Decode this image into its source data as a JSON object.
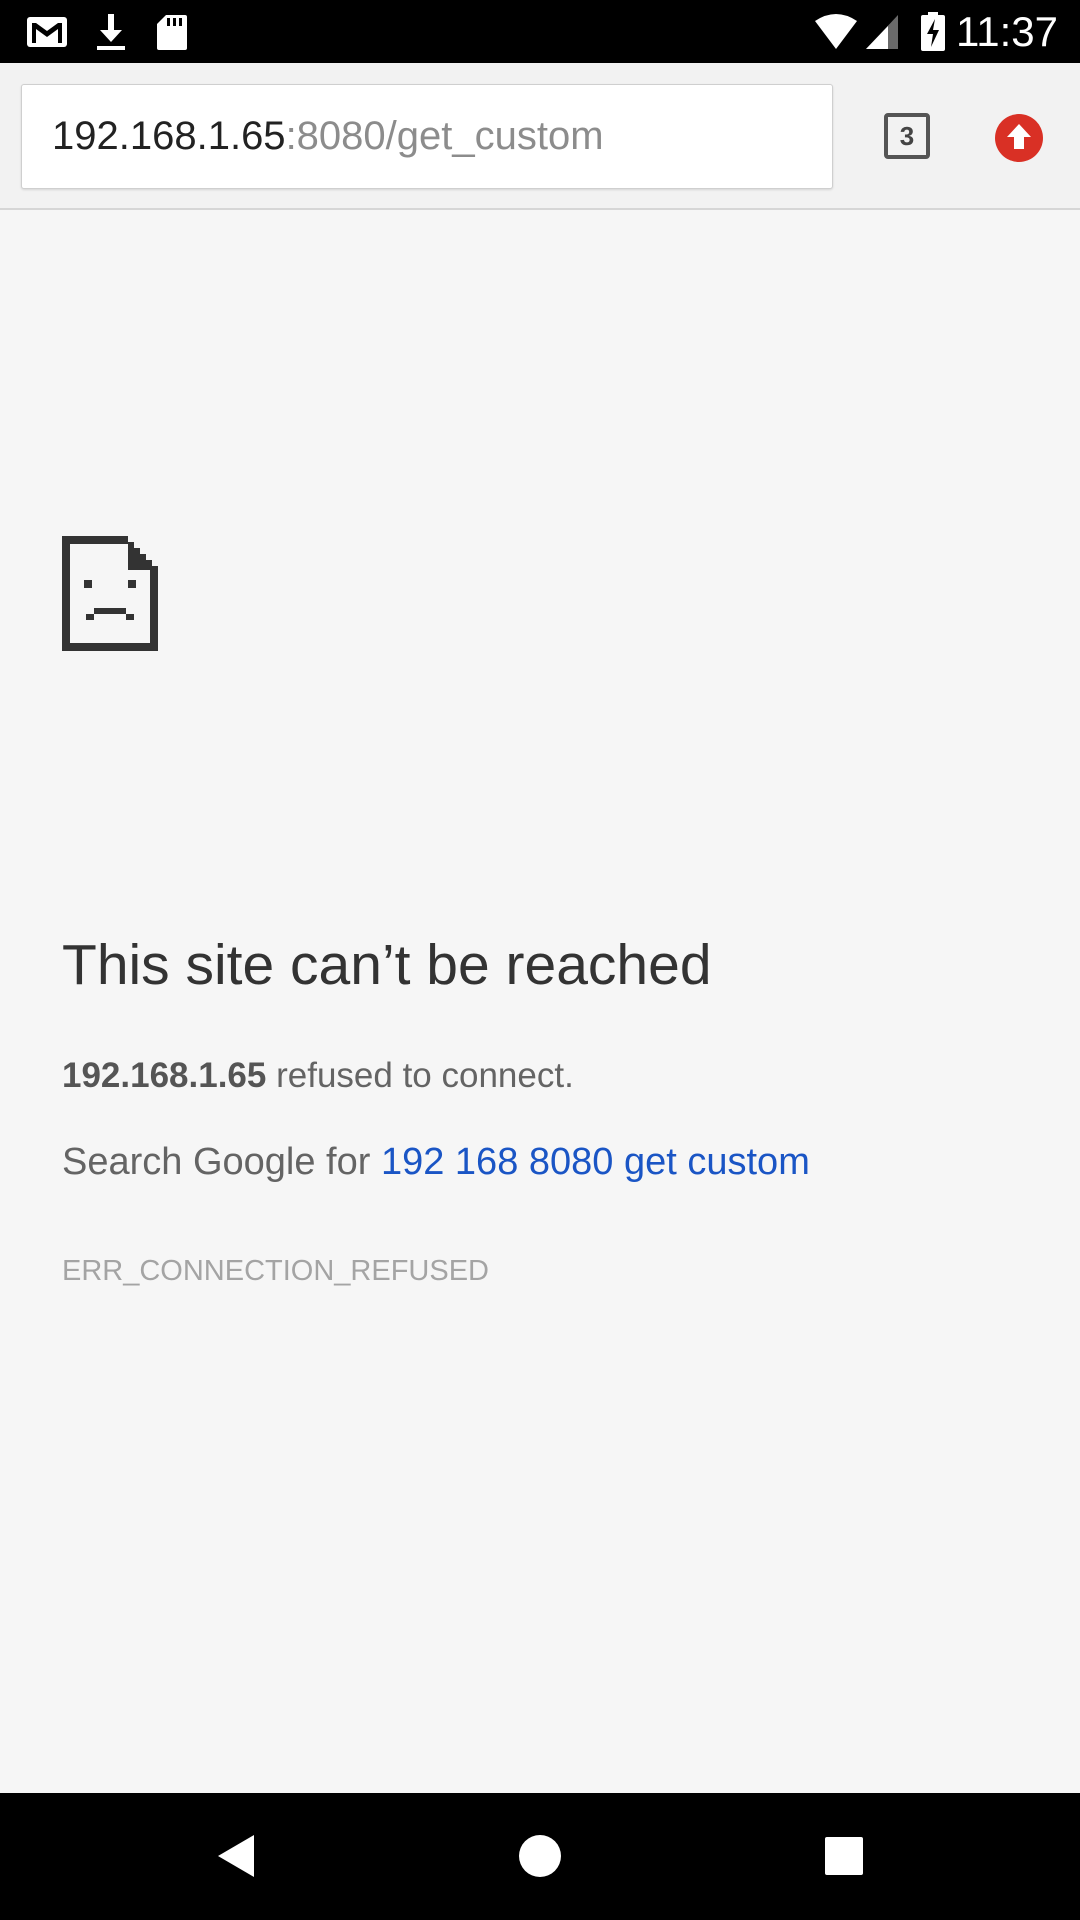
{
  "status_bar": {
    "time": "11:37",
    "icons_left": [
      "gmail-icon",
      "download-icon",
      "sd-card-icon"
    ],
    "icons_right": [
      "wifi-icon",
      "cell-signal-icon",
      "battery-charging-icon"
    ]
  },
  "toolbar": {
    "url_host": "192.168.1.65",
    "url_path": ":8080/get_custom",
    "tab_count": "3",
    "update_icon": "update-arrow-icon"
  },
  "error_page": {
    "icon": "sad-page-icon",
    "title": "This site can’t be reached",
    "host": "192.168.1.65",
    "refused_suffix": " refused to connect.",
    "search_prefix": "Search Google for ",
    "search_link": "192 168 8080 get custom",
    "error_code": "ERR_CONNECTION_REFUSED"
  },
  "nav_bar": {
    "buttons": [
      "back-icon",
      "home-icon",
      "recents-icon"
    ]
  },
  "colors": {
    "link": "#1a55c5",
    "update_red": "#d93025",
    "page_background": "#f6f6f6"
  }
}
